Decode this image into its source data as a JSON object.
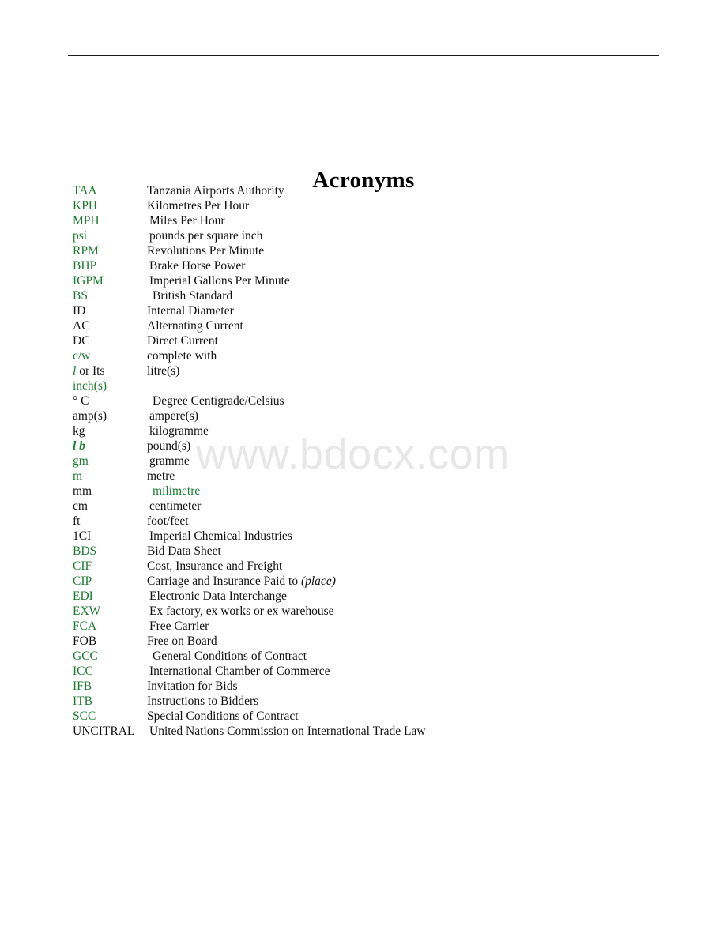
{
  "document": {
    "title": "Acronyms",
    "watermark": "www.bdocx.com"
  },
  "colors": {
    "green": "#1a7a2e",
    "black": "#111111",
    "watermark": "#e7e7e7",
    "rule": "#1a1a1a"
  },
  "acronyms": [
    {
      "term": "TAA",
      "definition": "Tanzania Airports Authority"
    },
    {
      "term": "KPH",
      "definition": "Kilometres Per Hour"
    },
    {
      "term": "MPH",
      "definition": "Miles Per Hour"
    },
    {
      "term": "psi",
      "definition": "pounds per square inch"
    },
    {
      "term": "RPM",
      "definition": "Revolutions Per Minute"
    },
    {
      "term": "BHP",
      "definition": "Brake Horse Power"
    },
    {
      "term": "IGPM",
      "definition": "Imperial Gallons Per Minute"
    },
    {
      "term": "BS",
      "definition": "British Standard"
    },
    {
      "term": "ID",
      "definition": "Internal Diameter"
    },
    {
      "term": "AC",
      "definition": "Alternating Current"
    },
    {
      "term": "DC",
      "definition": "Direct Current"
    },
    {
      "term": "c/w",
      "definition": "complete with"
    },
    {
      "term": "l or Its",
      "definition": "litre(s)"
    },
    {
      "term": "inch(s)",
      "definition": ""
    },
    {
      "term": "°  C",
      "definition": "Degree Centigrade/Celsius"
    },
    {
      "term": "amp(s)",
      "definition": "ampere(s)"
    },
    {
      "term": "kg",
      "definition": "kilogramme"
    },
    {
      "term": "l b",
      "definition": "pound(s)"
    },
    {
      "term": "gm",
      "definition": "gramme"
    },
    {
      "term": "m",
      "definition": "metre"
    },
    {
      "term": "mm",
      "definition": "milimetre"
    },
    {
      "term": "cm",
      "definition": "centimeter"
    },
    {
      "term": "ft",
      "definition": "foot/feet"
    },
    {
      "term": "1CI",
      "definition": "Imperial Chemical Industries"
    },
    {
      "term": "BDS",
      "definition": "Bid Data Sheet"
    },
    {
      "term": "CIF",
      "definition": "Cost, Insurance and Freight"
    },
    {
      "term": "CIP",
      "definition": "Carriage and Insurance Paid to (place)"
    },
    {
      "term": "EDI",
      "definition": "Electronic Data Interchange"
    },
    {
      "term": "EXW",
      "definition": "Ex factory, ex works or ex warehouse"
    },
    {
      "term": "FCA",
      "definition": "Free Carrier"
    },
    {
      "term": "FOB",
      "definition": "Free on Board"
    },
    {
      "term": "GCC",
      "definition": "General Conditions of Contract"
    },
    {
      "term": "ICC",
      "definition": "International Chamber of Commerce"
    },
    {
      "term": "IFB",
      "definition": "Invitation for Bids"
    },
    {
      "term": "ITB",
      "definition": "Instructions to Bidders"
    },
    {
      "term": "SCC",
      "definition": "Special Conditions of Contract"
    },
    {
      "term": "UNCITRAL",
      "definition": "United Nations Commission on International Trade Law"
    }
  ]
}
